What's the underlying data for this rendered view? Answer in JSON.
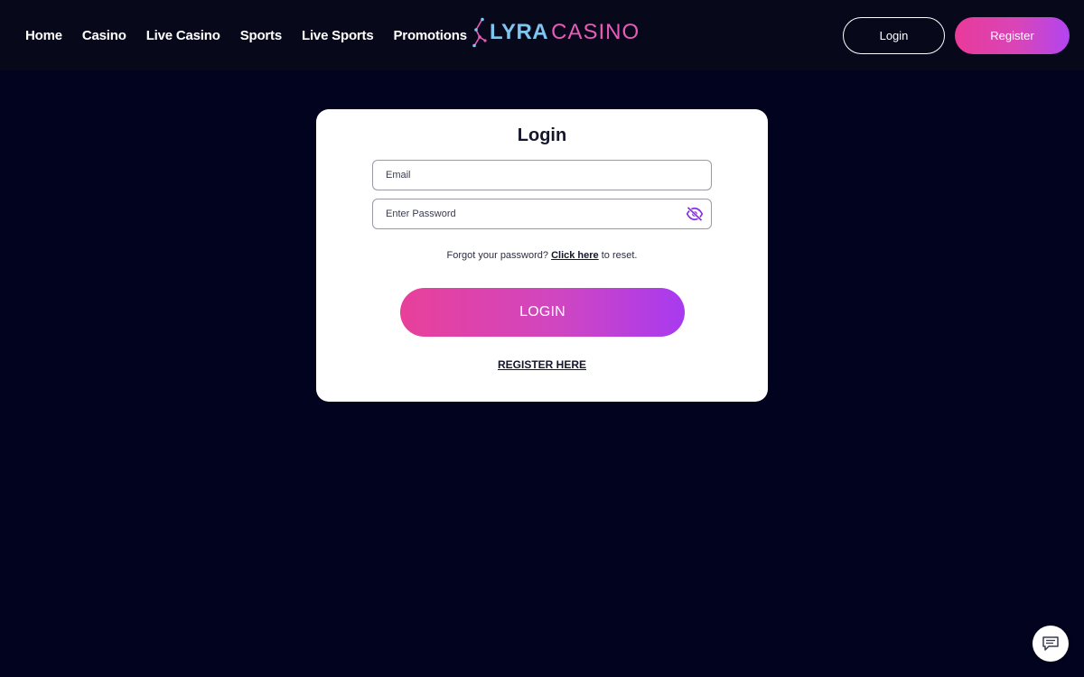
{
  "header": {
    "nav": [
      {
        "label": "Home"
      },
      {
        "label": "Casino"
      },
      {
        "label": "Live Casino"
      },
      {
        "label": "Sports"
      },
      {
        "label": "Live Sports"
      },
      {
        "label": "Promotions"
      }
    ],
    "logo": {
      "part1": "LYRA",
      "part2": "CASINO"
    },
    "login_label": "Login",
    "register_label": "Register"
  },
  "login_form": {
    "title": "Login",
    "email_placeholder": "Email",
    "password_placeholder": "Enter Password",
    "forgot_prefix": "Forgot your password?",
    "forgot_link": "Click here",
    "forgot_suffix": "to reset.",
    "submit_label": "LOGIN",
    "register_link": "REGISTER HERE"
  },
  "icons": {
    "password_toggle": "eye-slash-icon",
    "chat": "chat-icon"
  },
  "colors": {
    "background": "#02031f",
    "header": "#07081a",
    "accent_pink": "#e93a9a",
    "accent_purple": "#a83af0",
    "eye_icon": "#8a2be2",
    "logo_blue": "#7fc6ee",
    "logo_pink": "#e95bb8"
  }
}
